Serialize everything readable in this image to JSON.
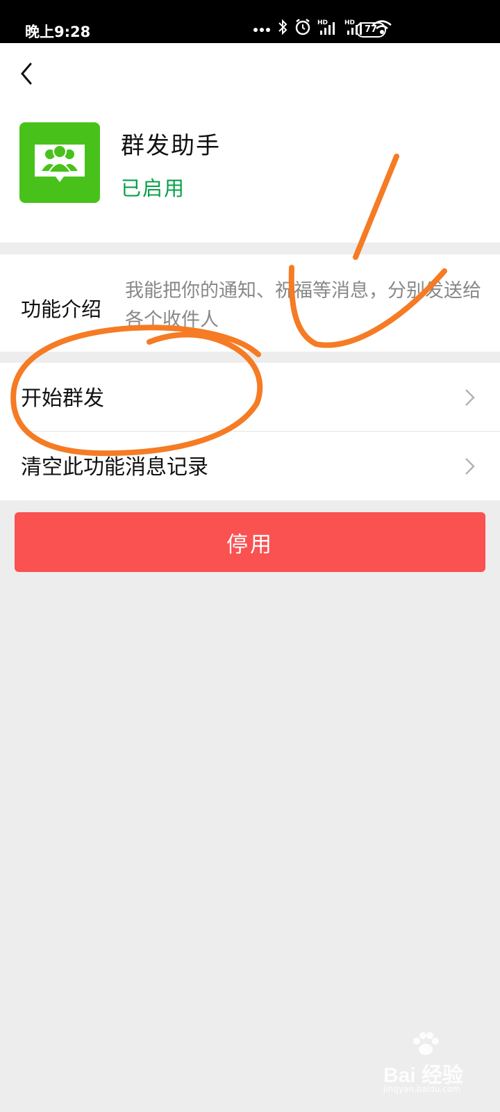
{
  "status_bar": {
    "time": "晚上9:28",
    "network_label_1": "HD",
    "network_label_2": "HD",
    "battery_level": "77",
    "icons": [
      "more-dots-icon",
      "bluetooth-icon",
      "alarm-icon",
      "signal-icon",
      "signal-icon",
      "wifi-icon",
      "battery-icon"
    ]
  },
  "header": {
    "back_icon": "back-chevron-icon"
  },
  "app": {
    "icon": "group-send-icon",
    "icon_color": "#48c21a",
    "name": "群发助手",
    "status": "已启用",
    "status_color": "#07a048"
  },
  "intro": {
    "label": "功能介绍",
    "text": "我能把你的通知、祝福等消息，分别发送给各个收件人"
  },
  "menu": {
    "items": [
      {
        "label": "开始群发"
      },
      {
        "label": "清空此功能消息记录"
      }
    ]
  },
  "actions": {
    "disable_label": "停用",
    "disable_color": "#fa5151"
  },
  "annotation": {
    "color": "#f57b24"
  },
  "watermark": {
    "brand": "Bai 经验",
    "url": "jingyan.baidu.com"
  }
}
